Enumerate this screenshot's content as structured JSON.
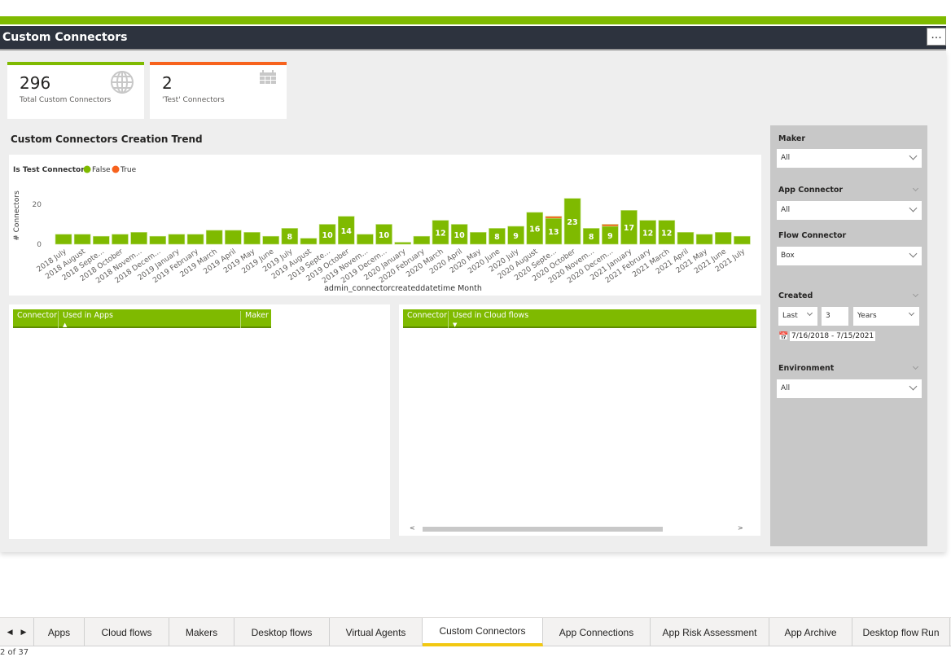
{
  "header": {
    "title": "Custom Connectors",
    "more_label": "..."
  },
  "cards": [
    {
      "value": "296",
      "label": "Total Custom Connectors",
      "icon": "globe-icon",
      "accent": "#7fba00"
    },
    {
      "value": "2",
      "label": "'Test' Connectors",
      "icon": "calendar-icon",
      "accent": "#f7621d"
    }
  ],
  "chart_title": "Custom Connectors Creation Trend",
  "chart_data": {
    "type": "bar",
    "stacked": true,
    "legend_title": "Is Test Connector",
    "legend_placement": "top-left",
    "ylabel": "# Connectors",
    "xlabel": "admin_connectorcreateddatetime Month",
    "yticks": [
      0,
      20
    ],
    "ylim": [
      0,
      24
    ],
    "grid": false,
    "categories": [
      "2018 July",
      "2018 August",
      "2018 Septe...",
      "2018 October",
      "2018 Novem...",
      "2018 Decem...",
      "2019 January",
      "2019 February",
      "2019 March",
      "2019 April",
      "2019 May",
      "2019 June",
      "2019 July",
      "2019 August",
      "2019 Septe...",
      "2019 October",
      "2019 Novem...",
      "2019 Decem...",
      "2020 January",
      "2020 February",
      "2020 March",
      "2020 April",
      "2020 May",
      "2020 June",
      "2020 July",
      "2020 August",
      "2020 Septe...",
      "2020 October",
      "2020 Novem...",
      "2020 Decem...",
      "2021 January",
      "2021 February",
      "2021 March",
      "2021 April",
      "2021 May",
      "2021 June",
      "2021 July"
    ],
    "series": [
      {
        "name": "False",
        "color": "#7fba00",
        "values": [
          5,
          5,
          4,
          5,
          6,
          4,
          5,
          5,
          7,
          7,
          6,
          4,
          8,
          3,
          10,
          14,
          5,
          10,
          1,
          4,
          12,
          10,
          6,
          8,
          9,
          16,
          13,
          23,
          8,
          9,
          17,
          12,
          12,
          6,
          5,
          6,
          4
        ]
      },
      {
        "name": "True",
        "color": "#f7621d",
        "values": [
          0,
          0,
          0,
          0,
          0,
          0,
          0,
          0,
          0,
          0,
          0,
          0,
          0,
          0,
          0,
          0,
          0,
          0,
          0,
          0,
          0,
          0,
          0,
          0,
          0,
          0,
          1,
          0,
          0,
          1,
          0,
          0,
          0,
          0,
          0,
          0,
          0
        ]
      }
    ],
    "data_labels": [
      "",
      "",
      "",
      "",
      "",
      "",
      "",
      "",
      "",
      "",
      "",
      "",
      "8",
      "",
      "10",
      "14",
      "",
      "10",
      "",
      "",
      "12",
      "10",
      "",
      "8",
      "9",
      "16",
      "13",
      "23",
      "8",
      "9",
      "17",
      "12",
      "12",
      "",
      "",
      "",
      ""
    ]
  },
  "apps_table": {
    "columns": [
      "Connector",
      "Used in Apps",
      "Maker"
    ],
    "sort": "ascending"
  },
  "flows_table": {
    "columns": [
      "Connector",
      "Used in Cloud flows"
    ],
    "sort": "descending"
  },
  "slicers": {
    "maker": {
      "title": "Maker",
      "value": "All"
    },
    "app_connector": {
      "title": "App Connector",
      "value": "All"
    },
    "flow_connector": {
      "title": "Flow Connector",
      "value": "Box"
    },
    "created": {
      "title": "Created",
      "mode": "Last",
      "count": "3",
      "unit": "Years",
      "range": "7/16/2018 - 7/15/2021"
    },
    "environment": {
      "title": "Environment",
      "value": "All"
    }
  },
  "tabs": [
    "Apps",
    "Cloud flows",
    "Makers",
    "Desktop flows",
    "Virtual Agents",
    "Custom Connectors",
    "App Connections",
    "App Risk Assessment",
    "App Archive",
    "Desktop flow Run"
  ],
  "active_tab": "Custom Connectors",
  "status": "2 of 37"
}
